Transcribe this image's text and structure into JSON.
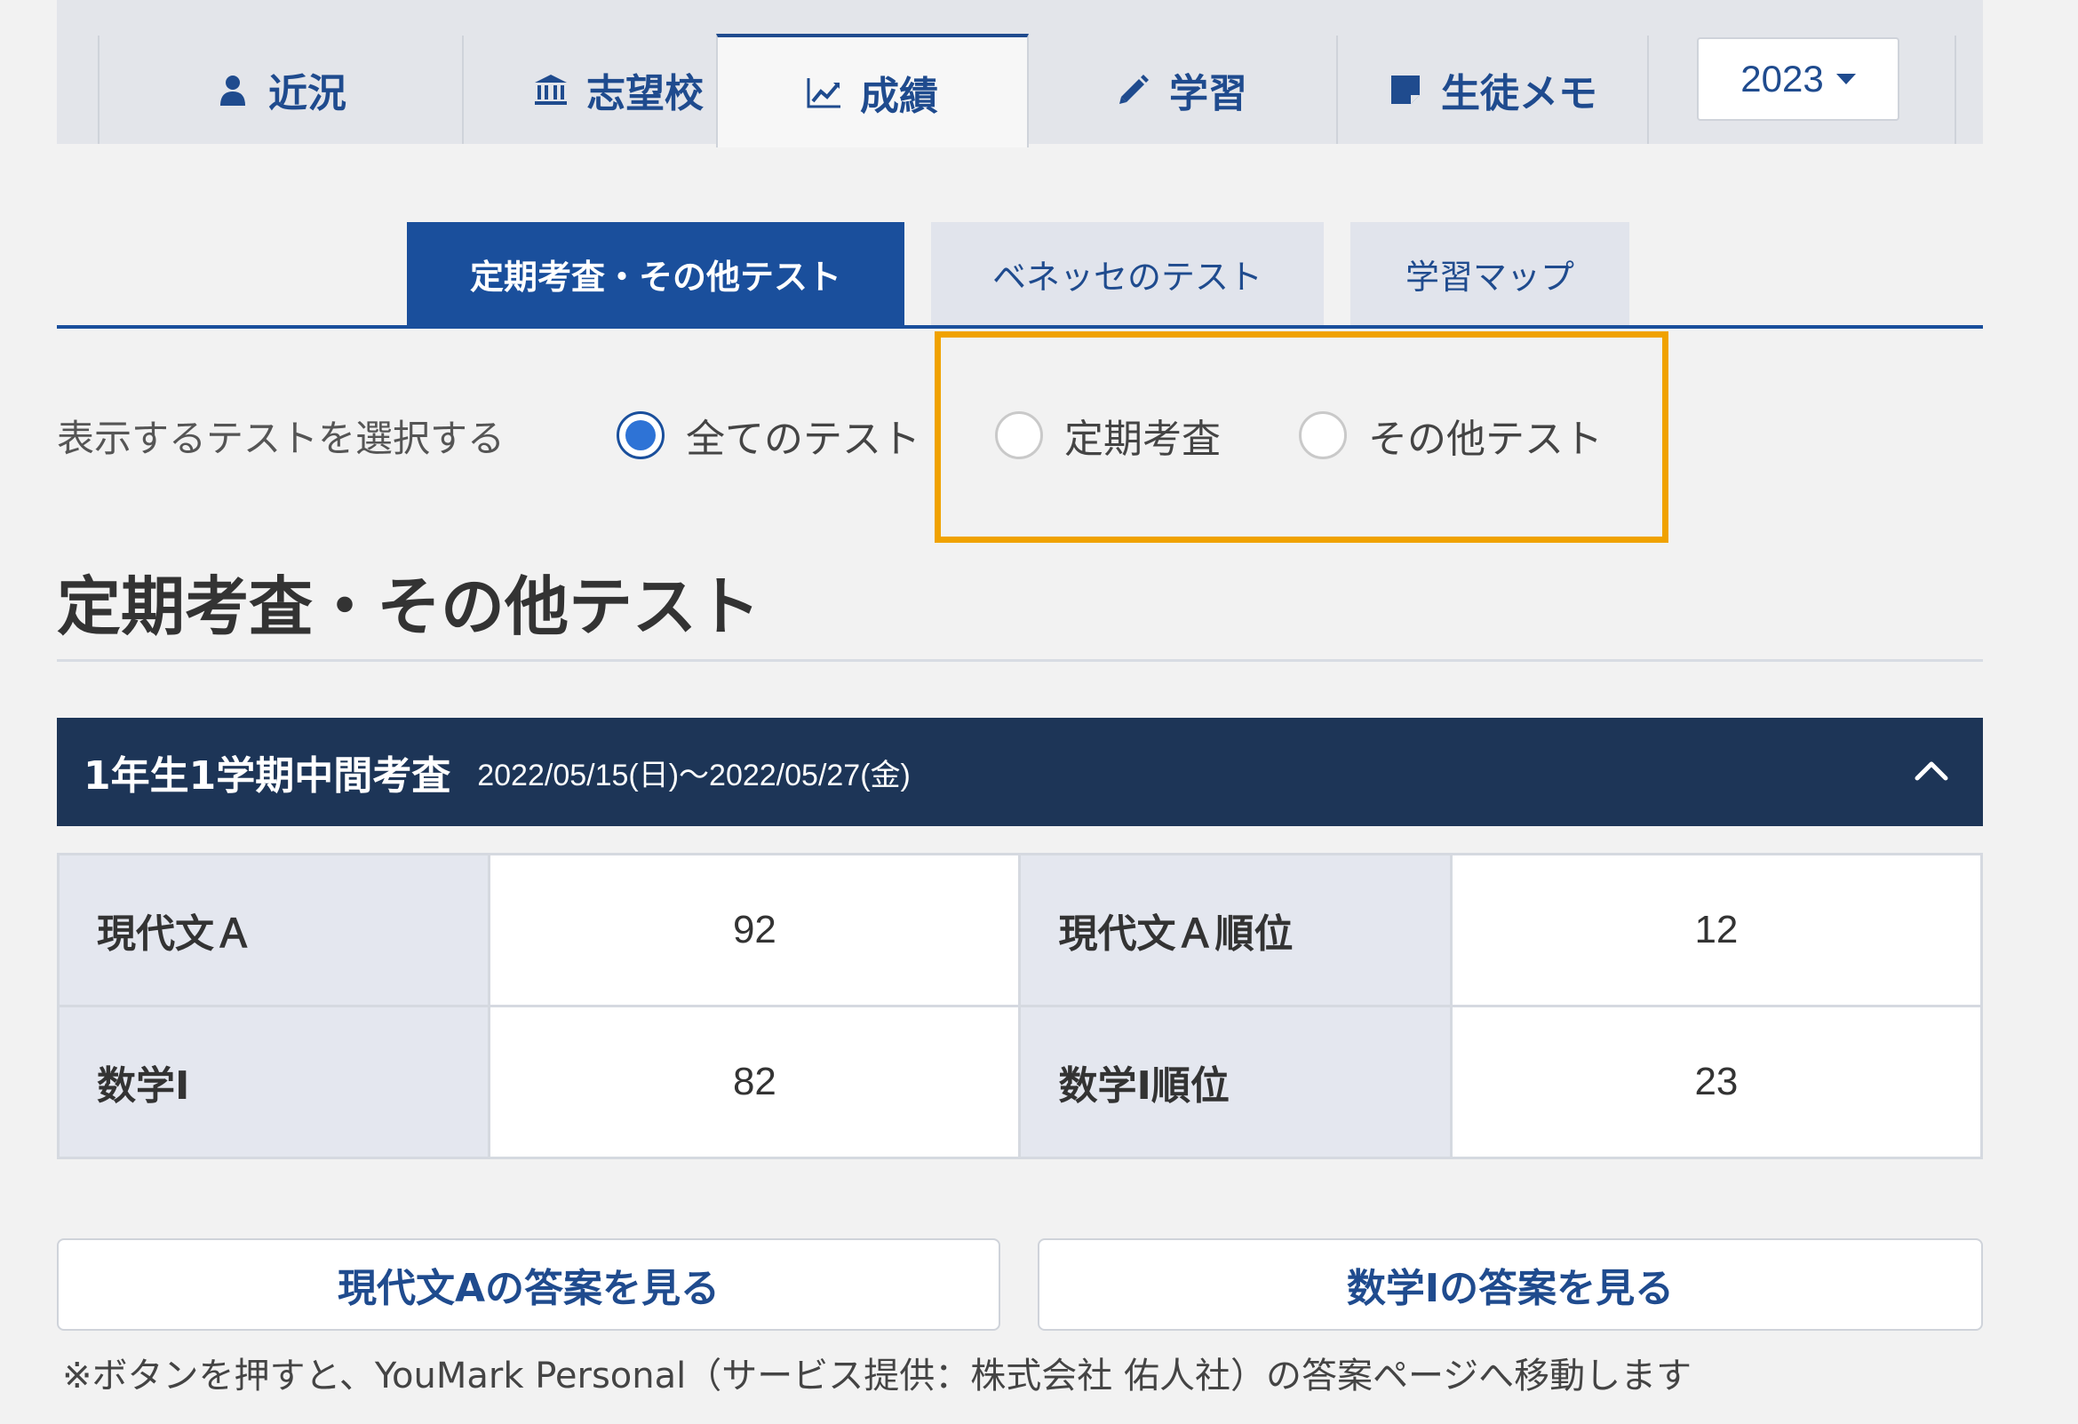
{
  "top_tabs": [
    {
      "label": "近況",
      "icon": "user-icon"
    },
    {
      "label": "志望校",
      "icon": "institution-icon"
    },
    {
      "label": "成績",
      "icon": "line-chart-icon",
      "active": true
    },
    {
      "label": "学習",
      "icon": "pencil-icon"
    },
    {
      "label": "生徒メモ",
      "icon": "note-icon"
    }
  ],
  "year_select": {
    "value": "2023"
  },
  "sub_tabs": [
    {
      "label": "定期考査・その他テスト",
      "active": true
    },
    {
      "label": "ベネッセのテスト"
    },
    {
      "label": "学習マップ"
    }
  ],
  "filter": {
    "label": "表示するテストを選択する",
    "options": [
      {
        "label": "全てのテスト",
        "checked": true
      },
      {
        "label": "定期考査",
        "checked": false
      },
      {
        "label": "その他テスト",
        "checked": false
      }
    ]
  },
  "section_title": "定期考査・その他テスト",
  "exam": {
    "name": "1年生1学期中間考査",
    "dates": "2022/05/15(日)〜2022/05/27(金)"
  },
  "scores": [
    {
      "subject": "現代文Ａ",
      "score": "92",
      "rank_label": "現代文Ａ順位",
      "rank": "12"
    },
    {
      "subject": "数学Ⅰ",
      "score": "82",
      "rank_label": "数学Ⅰ順位",
      "rank": "23"
    }
  ],
  "answer_buttons": [
    "現代文Aの答案を見る",
    "数学Ⅰの答案を見る"
  ],
  "note": "※ボタンを押すと、YouMark Personal（サービス提供：株式会社 佑人社）の答案ページへ移動します",
  "colors": {
    "brand": "#1a4f9c",
    "header_dark": "#1d3557",
    "highlight": "#f0a200"
  }
}
